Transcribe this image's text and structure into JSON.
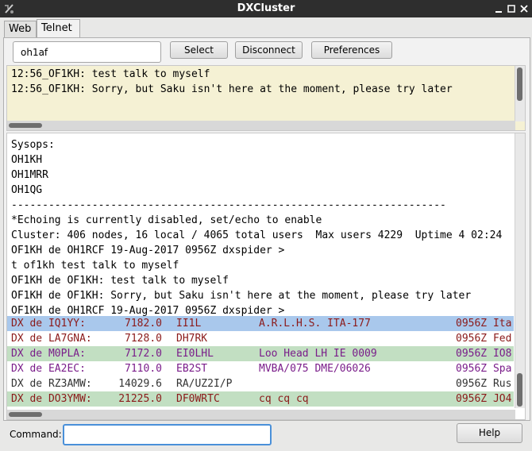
{
  "window": {
    "title": "DXCluster",
    "controls": [
      "minimize-icon",
      "maximize-icon",
      "close-icon"
    ]
  },
  "tabs": [
    {
      "label": "Web",
      "active": false
    },
    {
      "label": "Telnet",
      "active": true
    }
  ],
  "toolbar": {
    "callsign_value": "oh1af",
    "select_label": "Select",
    "disconnect_label": "Disconnect",
    "preferences_label": "Preferences"
  },
  "chat": {
    "lines": [
      "12:56_OF1KH: test talk to myself",
      "12:56_OF1KH: Sorry, but Saku isn't here at the moment, please try later"
    ],
    "background": "#f5f1d4"
  },
  "console": {
    "lines": [
      "Sysops:",
      "OH1KH",
      "OH1MRR",
      "OH1QG",
      "----------------------------------------------------------------------",
      "*Echoing is currently disabled, set/echo to enable",
      "Cluster: 406 nodes, 16 local / 4065 total users  Max users 4229  Uptime 4 02:24",
      "OF1KH de OH1RCF 19-Aug-2017 0956Z dxspider >",
      "t of1kh test talk to myself",
      "OF1KH de OF1KH: test talk to myself",
      "OF1KH de OF1KH: Sorry, but Saku isn't here at the moment, please try later",
      "OF1KH de OH1RCF 19-Aug-2017 0956Z dxspider >"
    ],
    "spots": [
      {
        "de": "DX de IQ1YY:",
        "freq": "7182.0",
        "call": "II1L",
        "comment": "A.R.L.H.S. ITA-177",
        "time": "0956Z Ita",
        "bg": "#a9c8ec",
        "fg": "#8b1a1a"
      },
      {
        "de": "DX de LA7GNA:",
        "freq": "7128.0",
        "call": "DH7RK",
        "comment": "",
        "time": "0956Z Fed",
        "bg": "#ffffff",
        "fg": "#8b1a1a"
      },
      {
        "de": "DX de M0PLA:",
        "freq": "7172.0",
        "call": "EI0LHL",
        "comment": "Loo Head LH IE 0009",
        "time": "0956Z IO8",
        "bg": "#c2dfc2",
        "fg": "#7a1d8a"
      },
      {
        "de": "DX de EA2EC:",
        "freq": "7110.0",
        "call": "EB2ST",
        "comment": "MVBA/075 DME/06026",
        "time": "0956Z Spa",
        "bg": "#ffffff",
        "fg": "#7a1d8a"
      },
      {
        "de": "DX de RZ3AMW:",
        "freq": "14029.6",
        "call": "RA/UZ2I/P",
        "comment": "",
        "time": "0956Z Rus",
        "bg": "#ffffff",
        "fg": "#333333"
      },
      {
        "de": "DX de DO3YMW:",
        "freq": "21225.0",
        "call": "DF0WRTC",
        "comment": "cq cq cq",
        "time": "0956Z JO4",
        "bg": "#c2dfc2",
        "fg": "#8b1a1a"
      }
    ]
  },
  "command": {
    "label": "Command:",
    "value": "",
    "help_label": "Help"
  }
}
